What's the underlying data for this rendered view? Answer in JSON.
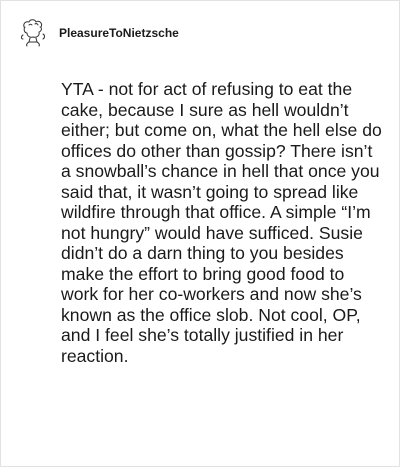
{
  "post": {
    "username": "PleasureToNietzsche",
    "avatar_icon": "sketch-avatar-icon",
    "comment": "YTA - not for act of refusing to eat the cake, because I sure as hell wouldn’t either; but come on, what the hell else do offices do other than gossip? There isn’t a snowball’s chance in hell that once you said that, it wasn’t going to spread like wildfire through that office. A simple “I’m not hungry” would have sufficed. Susie didn’t do a darn thing to you besides make the effort to bring good food to work for her co-workers and now she’s known as the office slob. Not cool, OP, and I feel she’s totally justified in her reaction."
  }
}
